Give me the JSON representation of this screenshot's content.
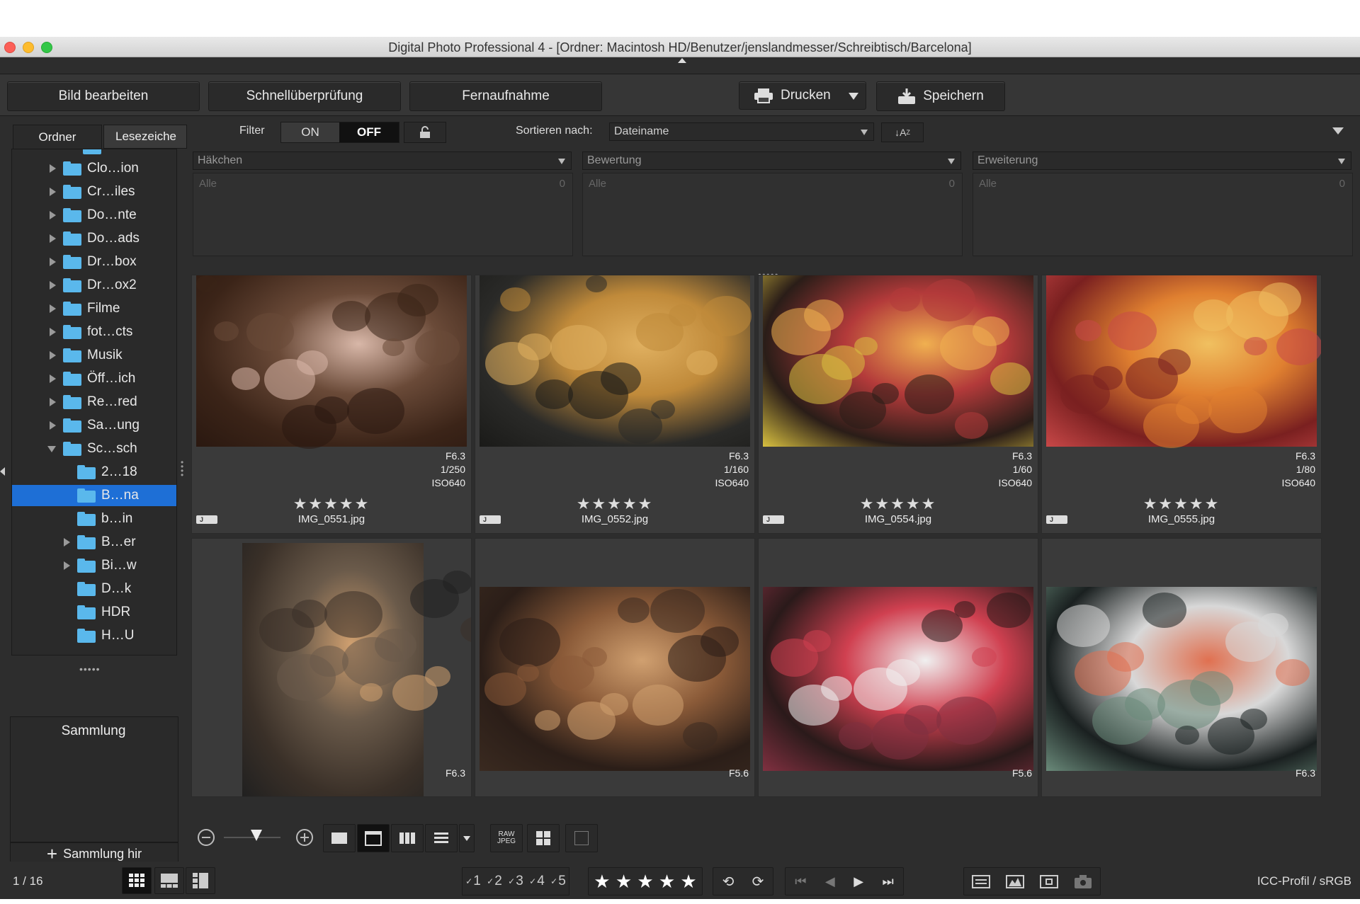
{
  "window": {
    "title": "Digital Photo Professional 4 - [Ordner: Macintosh HD/Benutzer/jenslandmesser/Schreibtisch/Barcelona]"
  },
  "toolbar": {
    "edit_label": "Bild bearbeiten",
    "quick_label": "Schnellüberprüfung",
    "remote_label": "Fernaufnahme",
    "print_label": "Drucken",
    "save_label": "Speichern"
  },
  "left_panel": {
    "tab_folder": "Ordner",
    "tab_bookmarks": "Lesezeiche",
    "folders": [
      {
        "label": "Clo…ion",
        "expandable": true,
        "indent": 0
      },
      {
        "label": "Cr…iles",
        "expandable": true,
        "indent": 0
      },
      {
        "label": "Do…nte",
        "expandable": true,
        "indent": 0
      },
      {
        "label": "Do…ads",
        "expandable": true,
        "indent": 0
      },
      {
        "label": "Dr…box",
        "expandable": true,
        "indent": 0
      },
      {
        "label": "Dr…ox2",
        "expandable": true,
        "indent": 0
      },
      {
        "label": "Filme",
        "expandable": true,
        "indent": 0
      },
      {
        "label": "fot…cts",
        "expandable": true,
        "indent": 0
      },
      {
        "label": "Musik",
        "expandable": true,
        "indent": 0
      },
      {
        "label": "Öff…ich",
        "expandable": true,
        "indent": 0
      },
      {
        "label": "Re…red",
        "expandable": true,
        "indent": 0
      },
      {
        "label": "Sa…ung",
        "expandable": true,
        "indent": 0
      },
      {
        "label": "Sc…sch",
        "expandable": "open",
        "indent": 0
      },
      {
        "label": "2…18",
        "expandable": false,
        "indent": 1
      },
      {
        "label": "B…na",
        "expandable": false,
        "indent": 1,
        "selected": true
      },
      {
        "label": "b…in",
        "expandable": false,
        "indent": 1
      },
      {
        "label": "B…er",
        "expandable": true,
        "indent": 1
      },
      {
        "label": "Bi…w",
        "expandable": true,
        "indent": 1
      },
      {
        "label": "D…k",
        "expandable": false,
        "indent": 1
      },
      {
        "label": "HDR",
        "expandable": false,
        "indent": 1
      },
      {
        "label": "H…U",
        "expandable": false,
        "indent": 1
      }
    ],
    "collection_title": "Sammlung",
    "add_collection_label": "Sammlung hir"
  },
  "filter": {
    "label": "Filter",
    "on_label": "ON",
    "off_label": "OFF",
    "sort_label": "Sortieren nach:",
    "sort_value": "Dateiname",
    "columns": [
      {
        "header": "Häkchen",
        "row_label": "Alle",
        "row_count": "0"
      },
      {
        "header": "Bewertung",
        "row_label": "Alle",
        "row_count": "0"
      },
      {
        "header": "Erweiterung",
        "row_label": "Alle",
        "row_count": "0"
      }
    ]
  },
  "thumbnails": [
    {
      "aperture": "F6.3",
      "shutter": "1/250",
      "iso": "ISO640",
      "rating": "★★★★★",
      "filename": "IMG_0551.jpg",
      "tag": "J"
    },
    {
      "aperture": "F6.3",
      "shutter": "1/160",
      "iso": "ISO640",
      "rating": "★★★★★",
      "filename": "IMG_0552.jpg",
      "tag": "J"
    },
    {
      "aperture": "F6.3",
      "shutter": "1/60",
      "iso": "ISO640",
      "rating": "★★★★★",
      "filename": "IMG_0554.jpg",
      "tag": "J"
    },
    {
      "aperture": "F6.3",
      "shutter": "1/80",
      "iso": "ISO640",
      "rating": "★★★★★",
      "filename": "IMG_0555.jpg",
      "tag": "J"
    },
    {
      "aperture": "F6.3"
    },
    {
      "aperture": "F5.6"
    },
    {
      "aperture": "F5.6"
    },
    {
      "aperture": "F6.3"
    }
  ],
  "controls": {
    "raw_label": "RAW JPEG"
  },
  "statusbar": {
    "count": "1 / 16",
    "rating_buttons": [
      "1",
      "2",
      "3",
      "4",
      "5"
    ],
    "stars": "★ ★ ★ ★ ★",
    "icc_label": "ICC-Profil / sRGB"
  },
  "colors": {
    "selection": "#1e6fd6",
    "folder": "#5ab8ec",
    "background": "#2d2d2d"
  }
}
